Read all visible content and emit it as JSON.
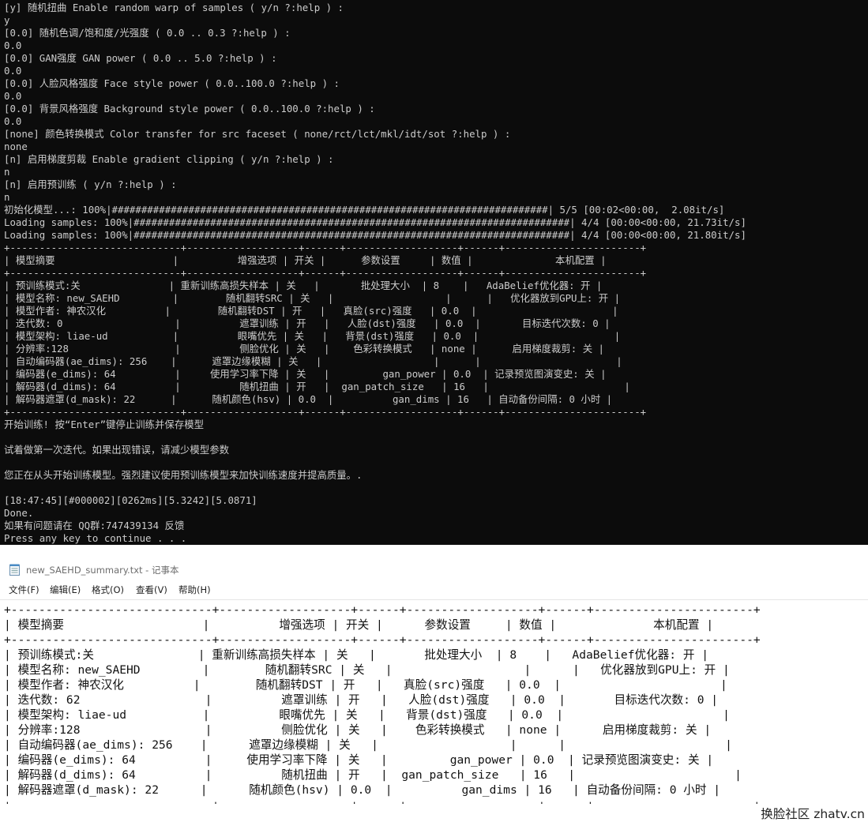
{
  "console": {
    "lines": [
      "[y] 随机扭曲 Enable random warp of samples ( y/n ?:help ) :",
      "y",
      "[0.0] 随机色调/饱和度/光强度 ( 0.0 .. 0.3 ?:help ) :",
      "0.0",
      "[0.0] GAN强度 GAN power ( 0.0 .. 5.0 ?:help ) :",
      "0.0",
      "[0.0] 人脸风格强度 Face style power ( 0.0..100.0 ?:help ) :",
      "0.0",
      "[0.0] 背景风格强度 Background style power ( 0.0..100.0 ?:help ) :",
      "0.0",
      "[none] 颜色转换模式 Color transfer for src faceset ( none/rct/lct/mkl/idt/sot ?:help ) :",
      "none",
      "[n] 启用梯度剪裁 Enable gradient clipping ( y/n ?:help ) :",
      "n",
      "[n] 启用预训练 ( y/n ?:help ) :",
      "n",
      "初始化模型...: 100%|##########################################################################| 5/5 [00:02<00:00,  2.08it/s]",
      "Loading samples: 100%|##########################################################################| 4/4 [00:00<00:00, 21.73it/s]",
      "Loading samples: 100%|##########################################################################| 4/4 [00:00<00:00, 21.80it/s]",
      "+-----------------------------+-------------------+------+-------------------+------+-----------------------+",
      "| 模型摘要                    |          增强选项 | 开关 |      参数设置     | 数值 |              本机配置 |",
      "+-----------------------------+-------------------+------+-------------------+------+-----------------------+",
      "| 预训练模式:关               | 重新训练高损失样本 | 关   |       批处理大小  | 8    |   AdaBelief优化器: 开 |",
      "| 模型名称: new_SAEHD         |        随机翻转SRC | 关   |                   |      |   优化器放到GPU上: 开 |",
      "| 模型作者: 神农汉化          |        随机翻转DST | 开   |   真脸(src)强度   | 0.0  |                       |",
      "| 迭代数: 0                   |          遮罩训练 | 开   |   人脸(dst)强度   | 0.0  |       目标迭代次数: 0 |",
      "| 模型架构: liae-ud           |          眼嘴优先 | 关   |   背景(dst)强度   | 0.0  |                       |",
      "| 分辨率:128                  |          侧脸优化 | 关   |    色彩转换模式   | none |      启用梯度裁剪: 关 |",
      "| 自动编码器(ae_dims): 256    |      遮罩边缘模糊 | 关   |                   |      |                       |",
      "| 编码器(e_dims): 64          |     使用学习率下降 | 关   |         gan_power | 0.0  | 记录预览图演变史: 关 |",
      "| 解码器(d_dims): 64          |          随机扭曲 | 开   |  gan_patch_size   | 16   |                       |",
      "| 解码器遮罩(d_mask): 22      |      随机颜色(hsv) | 0.0  |          gan_dims | 16   | 自动备份间隔: 0 小时 |",
      "+-----------------------------+-------------------+------+-------------------+------+-----------------------+",
      "开始训练! 按“Enter”键停止训练并保存模型",
      "",
      "试着做第一次迭代。如果出现错误，请减少模型参数",
      "",
      "您正在从头开始训练模型。强烈建议使用预训练模型来加快训练速度并提高质量。.",
      "",
      "[18:47:45][#000002][0262ms][5.3242][5.0871]",
      "Done.",
      "如果有问题请在 QQ群:747439134 反馈",
      "Press any key to continue . . ."
    ]
  },
  "notepad": {
    "title": "new_SAEHD_summary.txt - 记事本",
    "menu": [
      "文件(F)",
      "编辑(E)",
      "格式(O)",
      "查看(V)",
      "帮助(H)"
    ],
    "lines": [
      "+-----------------------------+-------------------+------+-------------------+------+-----------------------+",
      "| 模型摘要                    |          增强选项 | 开关 |      参数设置     | 数值 |              本机配置 |",
      "+-----------------------------+-------------------+------+-------------------+------+-----------------------+",
      "| 预训练模式:关               | 重新训练高损失样本 | 关   |       批处理大小  | 8    |   AdaBelief优化器: 开 |",
      "| 模型名称: new_SAEHD         |        随机翻转SRC | 关   |                   |      |   优化器放到GPU上: 开 |",
      "| 模型作者: 神农汉化          |        随机翻转DST | 开   |   真脸(src)强度   | 0.0  |                       |",
      "| 迭代数: 62                  |          遮罩训练 | 开   |   人脸(dst)强度   | 0.0  |       目标迭代次数: 0 |",
      "| 模型架构: liae-ud           |          眼嘴优先 | 关   |   背景(dst)强度   | 0.0  |                       |",
      "| 分辨率:128                  |          侧脸优化 | 关   |    色彩转换模式   | none |      启用梯度裁剪: 关 |",
      "| 自动编码器(ae_dims): 256    |      遮罩边缘模糊 | 关   |                   |      |                       |",
      "| 编码器(e_dims): 64          |     使用学习率下降 | 关   |         gan_power | 0.0  | 记录预览图演变史: 关 |",
      "| 解码器(d_dims): 64          |          随机扭曲 | 开   |  gan_patch_size   | 16   |                       |",
      "| 解码器遮罩(d_mask): 22      |      随机颜色(hsv) | 0.0  |          gan_dims | 16   | 自动备份间隔: 0 小时 |",
      "+-----------------------------+-------------------+------+-------------------+------+-----------------------+"
    ]
  },
  "watermark": "换脸社区 zhatv.cn"
}
